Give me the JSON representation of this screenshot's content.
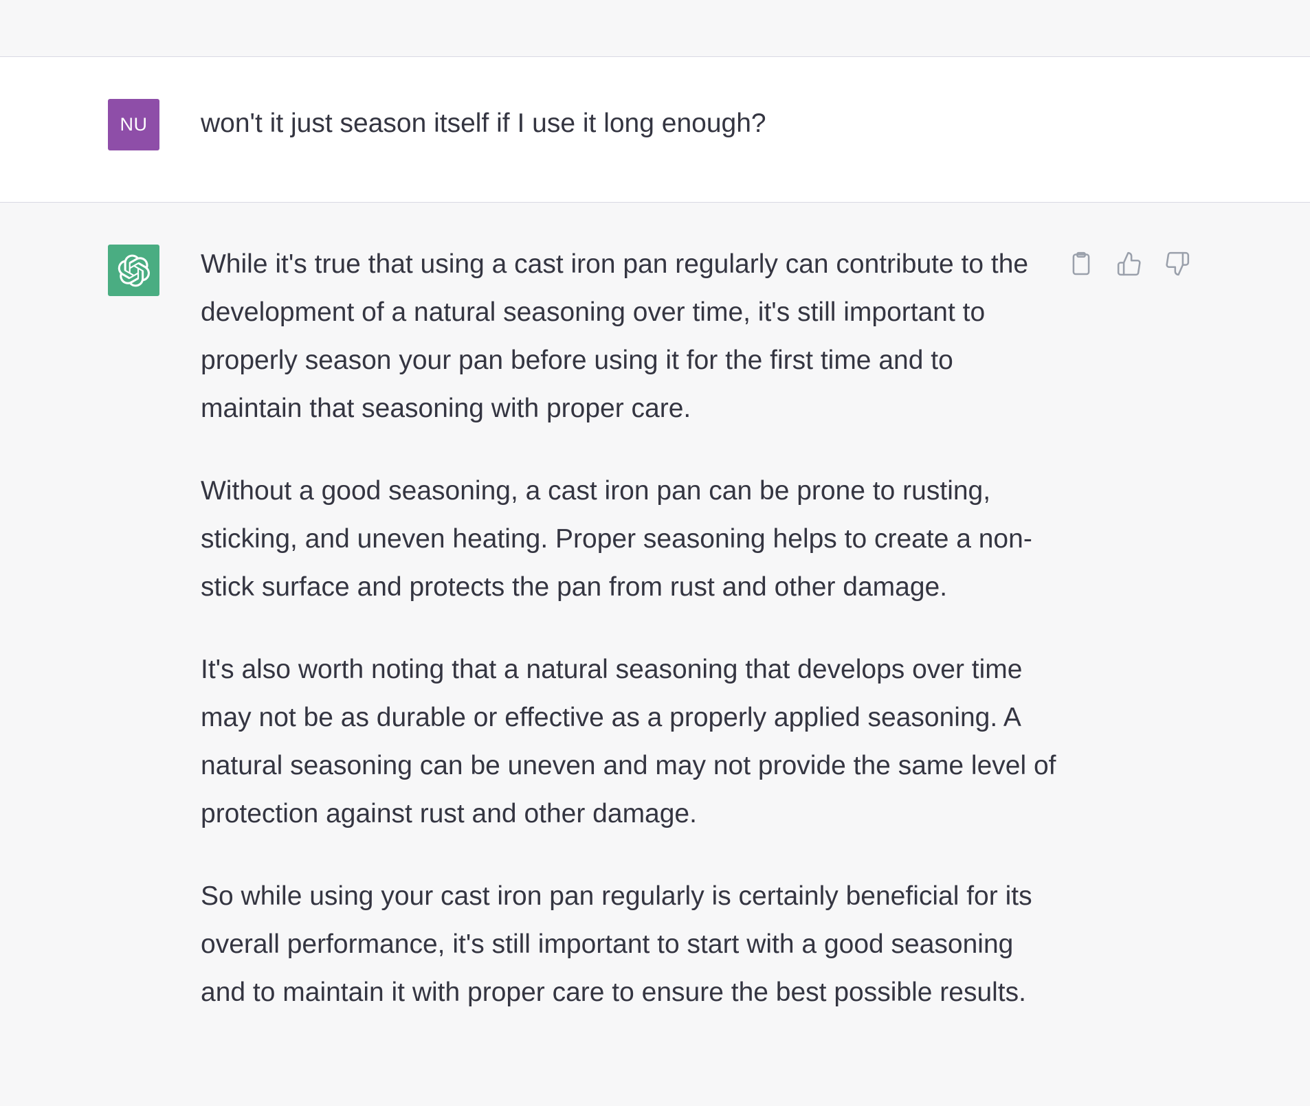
{
  "conversation": {
    "user_message": {
      "avatar_initials": "NU",
      "avatar_color": "#8e4ea8",
      "text": "won't it just season itself if I use it long enough?"
    },
    "assistant_message": {
      "avatar_icon": "openai-logo-icon",
      "avatar_color": "#4aad82",
      "paragraphs": [
        "While it's true that using a cast iron pan regularly can contribute to the development of a natural seasoning over time, it's still important to properly season your pan before using it for the first time and to maintain that seasoning with proper care.",
        "Without a good seasoning, a cast iron pan can be prone to rusting, sticking, and uneven heating. Proper seasoning helps to create a non-stick surface and protects the pan from rust and other damage.",
        "It's also worth noting that a natural seasoning that develops over time may not be as durable or effective as a properly applied seasoning. A natural seasoning can be uneven and may not provide the same level of protection against rust and other damage.",
        "So while using your cast iron pan regularly is certainly beneficial for its overall performance, it's still important to start with a good seasoning and to maintain it with proper care to ensure the best possible results."
      ],
      "actions": [
        {
          "icon": "clipboard-icon"
        },
        {
          "icon": "thumbs-up-icon"
        },
        {
          "icon": "thumbs-down-icon"
        }
      ]
    }
  }
}
